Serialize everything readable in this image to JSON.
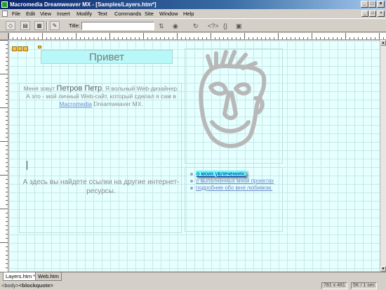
{
  "window": {
    "title": "Macromedia Dreamweaver MX - [Samples/Layers.htm*]",
    "controls": {
      "minimize": "_",
      "maximize": "□",
      "close": "×"
    }
  },
  "menu": {
    "items": [
      "File",
      "Edit",
      "View",
      "Insert",
      "Modify",
      "Text",
      "Commands",
      "Site",
      "Window",
      "Help"
    ]
  },
  "toolbar": {
    "title_label": "Title:",
    "title_value": ""
  },
  "page": {
    "greeting": "Привет",
    "intro_part1": "Меня зовут",
    "intro_name": "Петров Петр",
    "intro_part2": ". Я вольный Web-дизайнер. А это - мой личный Web-сайт, который сделал я сам в",
    "intro_link": "Macromedia",
    "intro_part3": "Dreamweaver MX.",
    "links_text": "А здесь вы найдете ссылки на другие интернет-ресурсы.",
    "list": [
      "о моих увлечениях;",
      "о выполненных мной проектах",
      "подробнее обо мне любимом."
    ]
  },
  "tabs": [
    "Layers.htm *",
    "Web.htm"
  ],
  "status": {
    "tags": [
      "<body>",
      "<blockquote>"
    ],
    "size": "781 x 481",
    "download": "5K / 1 sec"
  },
  "colors": {
    "canvas": "#e6ffff",
    "grid": "#c8e8e8",
    "greeting_bg": "#b8f8f8",
    "highlight": "#66ffff",
    "titlebar": "#0a246a"
  }
}
